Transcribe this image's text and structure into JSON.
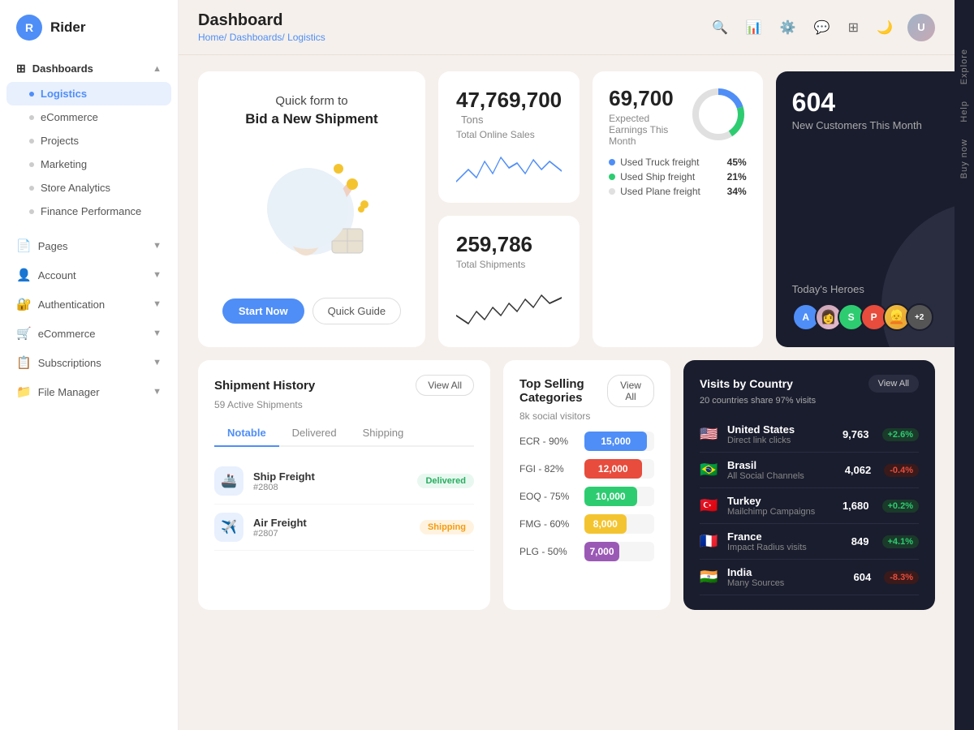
{
  "app": {
    "logo_letter": "R",
    "logo_text": "Rider"
  },
  "sidebar": {
    "dashboards_label": "Dashboards",
    "items": [
      {
        "id": "logistics",
        "label": "Logistics",
        "active": true
      },
      {
        "id": "ecommerce",
        "label": "eCommerce",
        "active": false
      },
      {
        "id": "projects",
        "label": "Projects",
        "active": false
      },
      {
        "id": "marketing",
        "label": "Marketing",
        "active": false
      },
      {
        "id": "store-analytics",
        "label": "Store Analytics",
        "active": false
      },
      {
        "id": "finance-performance",
        "label": "Finance Performance",
        "active": false
      }
    ],
    "pages_label": "Pages",
    "account_label": "Account",
    "authentication_label": "Authentication",
    "ecommerce_label": "eCommerce",
    "subscriptions_label": "Subscriptions",
    "file_manager_label": "File Manager"
  },
  "header": {
    "title": "Dashboard",
    "breadcrumb_home": "Home/",
    "breadcrumb_dashboards": "Dashboards/",
    "breadcrumb_current": "Logistics"
  },
  "quick_form": {
    "title": "Quick form to",
    "subtitle": "Bid a New Shipment",
    "btn_start": "Start Now",
    "btn_guide": "Quick Guide"
  },
  "stats": {
    "total_sales_value": "47,769,700",
    "total_sales_unit": "Tons",
    "total_sales_label": "Total Online Sales",
    "total_shipments_value": "259,786",
    "total_shipments_label": "Total Shipments",
    "earnings_value": "69,700",
    "earnings_label": "Expected Earnings This Month",
    "customers_value": "604",
    "customers_label": "New Customers This Month"
  },
  "freight": {
    "legend": [
      {
        "label": "Used Truck freight",
        "pct": "45%",
        "color": "#4f8ef7"
      },
      {
        "label": "Used Ship freight",
        "pct": "21%",
        "color": "#2ecc71"
      },
      {
        "label": "Used Plane freight",
        "pct": "34%",
        "color": "#e0e0e0"
      }
    ]
  },
  "heroes": {
    "title": "Today's Heroes",
    "avatars": [
      "A",
      "S",
      "P",
      "+2"
    ]
  },
  "shipment_history": {
    "title": "Shipment History",
    "subtitle": "59 Active Shipments",
    "view_all": "View All",
    "tabs": [
      "Notable",
      "Delivered",
      "Shipping"
    ],
    "active_tab": "Notable",
    "rows": [
      {
        "name": "Ship Freight",
        "id": "#2808",
        "status": "Delivered",
        "status_class": "status-delivered"
      },
      {
        "name": "Air Freight",
        "id": "#2807",
        "status": "Shipping",
        "status_class": "status-shipping"
      }
    ]
  },
  "categories": {
    "title": "Top Selling Categories",
    "subtitle": "8k social visitors",
    "view_all": "View All",
    "bars": [
      {
        "label": "ECR - 90%",
        "value": 15000,
        "display": "15,000",
        "color": "#4f8ef7",
        "width": "90%"
      },
      {
        "label": "FGI - 82%",
        "value": 12000,
        "display": "12,000",
        "color": "#e74c3c",
        "width": "82%"
      },
      {
        "label": "EOQ - 75%",
        "value": 10000,
        "display": "10,000",
        "color": "#2ecc71",
        "width": "75%"
      },
      {
        "label": "FMG - 60%",
        "value": 8000,
        "display": "8,000",
        "color": "#f4c430",
        "width": "60%"
      },
      {
        "label": "PLG - 50%",
        "value": 7000,
        "display": "7,000",
        "color": "#9b59b6",
        "width": "50%"
      }
    ]
  },
  "visits": {
    "title": "Visits by Country",
    "subtitle": "20 countries share 97% visits",
    "view_all": "View All",
    "countries": [
      {
        "flag": "🇺🇸",
        "name": "United States",
        "source": "Direct link clicks",
        "value": "9,763",
        "change": "+2.6%",
        "up": true
      },
      {
        "flag": "🇧🇷",
        "name": "Brasil",
        "source": "All Social Channels",
        "value": "4,062",
        "change": "-0.4%",
        "up": false
      },
      {
        "flag": "🇹🇷",
        "name": "Turkey",
        "source": "Mailchimp Campaigns",
        "value": "1,680",
        "change": "+0.2%",
        "up": true
      },
      {
        "flag": "🇫🇷",
        "name": "France",
        "source": "Impact Radius visits",
        "value": "849",
        "change": "+4.1%",
        "up": true
      },
      {
        "flag": "🇮🇳",
        "name": "India",
        "source": "Many Sources",
        "value": "604",
        "change": "-8.3%",
        "up": false
      }
    ]
  },
  "right_sidebar": {
    "labels": [
      "Explore",
      "Help",
      "Buy now"
    ]
  }
}
